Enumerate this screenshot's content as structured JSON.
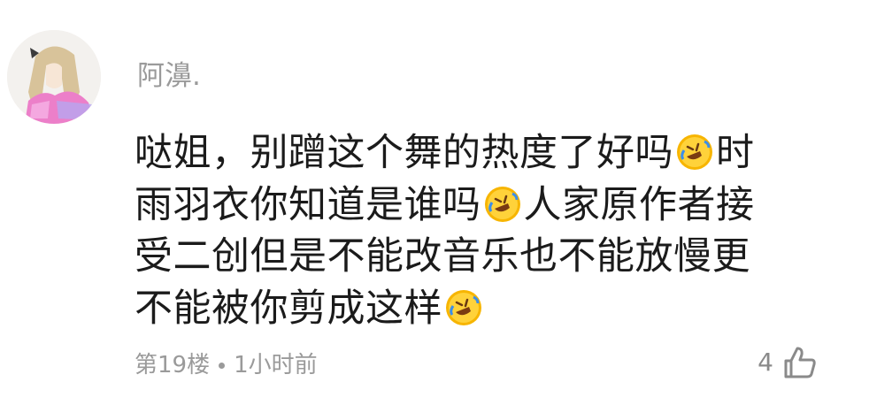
{
  "comment": {
    "username": "阿濞.",
    "lines": [
      [
        "哒姐，别蹭这个舞的热度了好吗",
        "[emoji]",
        "时"
      ],
      [
        "雨羽衣你知道是谁吗",
        "[emoji]",
        "人家原作者接"
      ],
      [
        "受二创但是不能改音乐也不能放慢更"
      ],
      [
        "不能被你剪成这样",
        "[emoji]"
      ]
    ],
    "floor": "第19楼",
    "time": "1小时前",
    "likes": "4",
    "icons": {
      "avatar": "avatar-anime-girl",
      "emoji": "rolling-on-floor-laughing-emoji",
      "like": "thumbs-up-icon"
    }
  }
}
